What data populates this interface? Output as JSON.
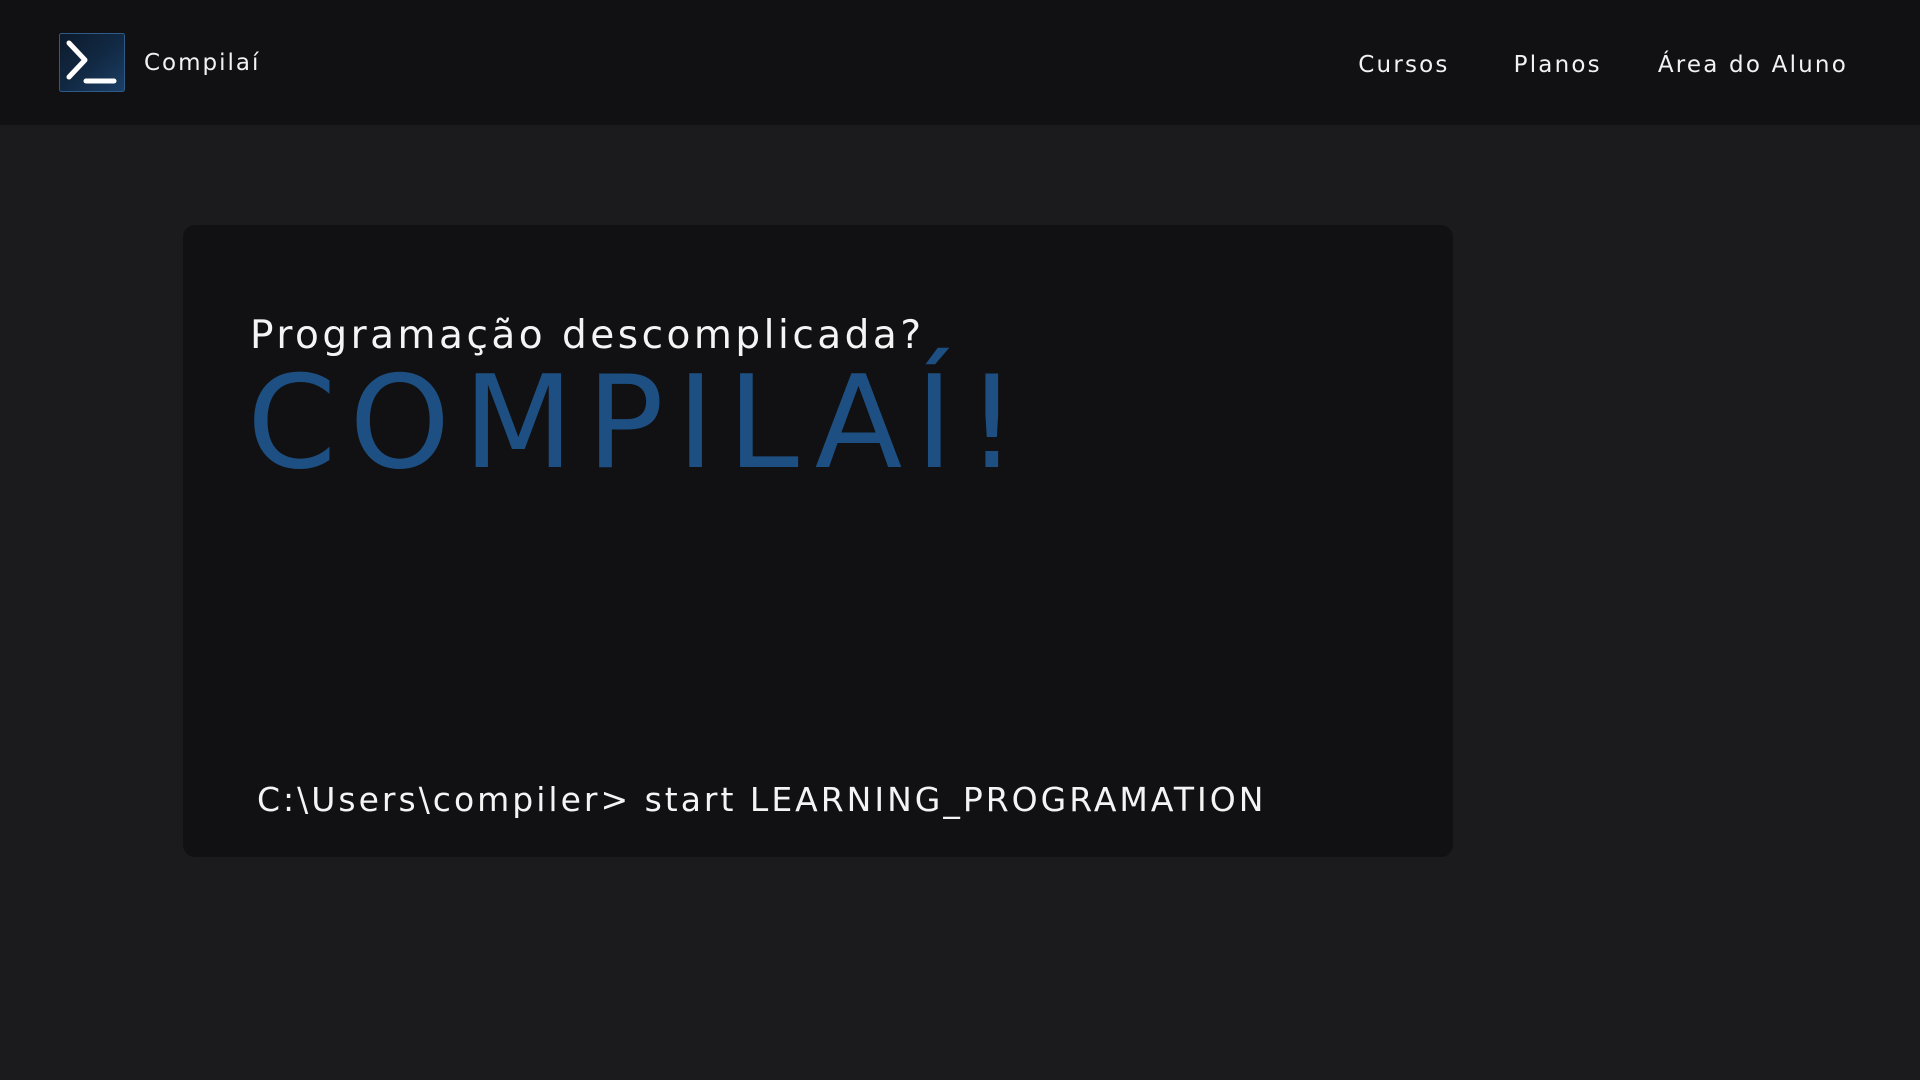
{
  "header": {
    "brand_name": "Compilaí",
    "logo_icon": "terminal-prompt-icon",
    "nav": [
      {
        "label": "Cursos"
      },
      {
        "label": "Planos"
      },
      {
        "label": "Área do Aluno"
      }
    ]
  },
  "hero": {
    "subtitle": "Programação descomplicada?",
    "title": "COMPILAÍ!",
    "command": "C:\\Users\\compiler> start LEARNING_PROGRAMATION"
  },
  "colors": {
    "page_background": "#1b1b1d",
    "header_background": "#111113",
    "card_background": "#111113",
    "accent_blue": "#1d4f82",
    "text": "#f4f4f4"
  }
}
